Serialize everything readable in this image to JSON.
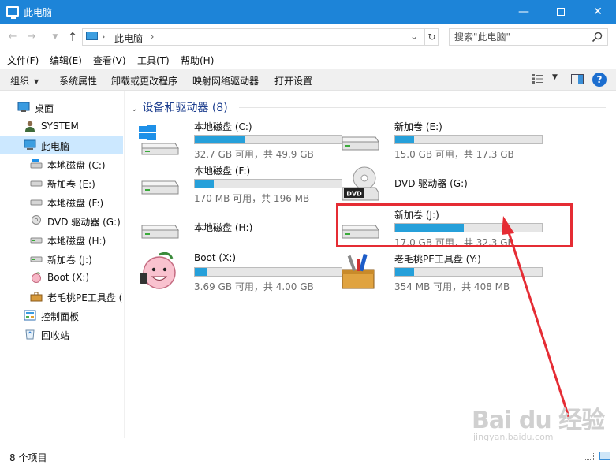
{
  "window": {
    "title": "此电脑"
  },
  "address": {
    "crumb": "此电脑",
    "search_placeholder": "搜索\"此电脑\""
  },
  "menu": {
    "items": [
      "文件(F)",
      "编辑(E)",
      "查看(V)",
      "工具(T)",
      "帮助(H)"
    ]
  },
  "toolbar": {
    "items": [
      "组织",
      "系统属性",
      "卸载或更改程序",
      "映射网络驱动器",
      "打开设置"
    ]
  },
  "sidebar": {
    "items": [
      {
        "label": "桌面",
        "icon": "desktop-icon"
      },
      {
        "label": "SYSTEM",
        "icon": "user-icon"
      },
      {
        "label": "此电脑",
        "icon": "computer-icon"
      },
      {
        "label": "本地磁盘 (C:)",
        "icon": "windows-drive-icon"
      },
      {
        "label": "新加卷 (E:)",
        "icon": "drive-icon"
      },
      {
        "label": "本地磁盘 (F:)",
        "icon": "drive-icon"
      },
      {
        "label": "DVD 驱动器 (G:)",
        "icon": "dvd-icon"
      },
      {
        "label": "本地磁盘 (H:)",
        "icon": "drive-icon"
      },
      {
        "label": "新加卷 (J:)",
        "icon": "drive-icon"
      },
      {
        "label": "Boot (X:)",
        "icon": "peach-icon"
      },
      {
        "label": "老毛桃PE工具盘 (",
        "icon": "toolbox-icon"
      },
      {
        "label": "控制面板",
        "icon": "control-panel-icon"
      },
      {
        "label": "回收站",
        "icon": "recycle-bin-icon"
      }
    ]
  },
  "content": {
    "group_title": "设备和驱动器 (8)",
    "drives": [
      {
        "name": "本地磁盘 (C:)",
        "free": "32.7 GB 可用，共 49.9 GB",
        "used_fraction": 0.34,
        "icon": "windows-drive-icon"
      },
      {
        "name": "新加卷 (E:)",
        "free": "15.0 GB 可用，共 17.3 GB",
        "used_fraction": 0.13,
        "icon": "drive-icon"
      },
      {
        "name": "本地磁盘 (F:)",
        "free": "170 MB 可用，共 196 MB",
        "used_fraction": 0.13,
        "icon": "drive-icon"
      },
      {
        "name": "DVD 驱动器 (G:)",
        "free": "",
        "used_fraction": null,
        "icon": "dvd-icon"
      },
      {
        "name": "本地磁盘 (H:)",
        "free": "",
        "used_fraction": null,
        "icon": "drive-icon"
      },
      {
        "name": "新加卷 (J:)",
        "free": "17.0 GB 可用，共 32.3 GB",
        "used_fraction": 0.47,
        "icon": "drive-icon"
      },
      {
        "name": "Boot (X:)",
        "free": "3.69 GB 可用，共 4.00 GB",
        "used_fraction": 0.08,
        "icon": "peach-icon"
      },
      {
        "name": "老毛桃PE工具盘 (Y:)",
        "free": "354 MB 可用，共 408 MB",
        "used_fraction": 0.13,
        "icon": "toolbox-icon"
      }
    ]
  },
  "status": {
    "text": "8 个项目"
  },
  "watermark": {
    "main": "Bai du 经验",
    "sub": "jingyan.baidu.com"
  },
  "colors": {
    "titlebar": "#1d84d8",
    "accent": "#26a0da",
    "highlight": "#e52c34",
    "selected": "#cce8ff"
  }
}
